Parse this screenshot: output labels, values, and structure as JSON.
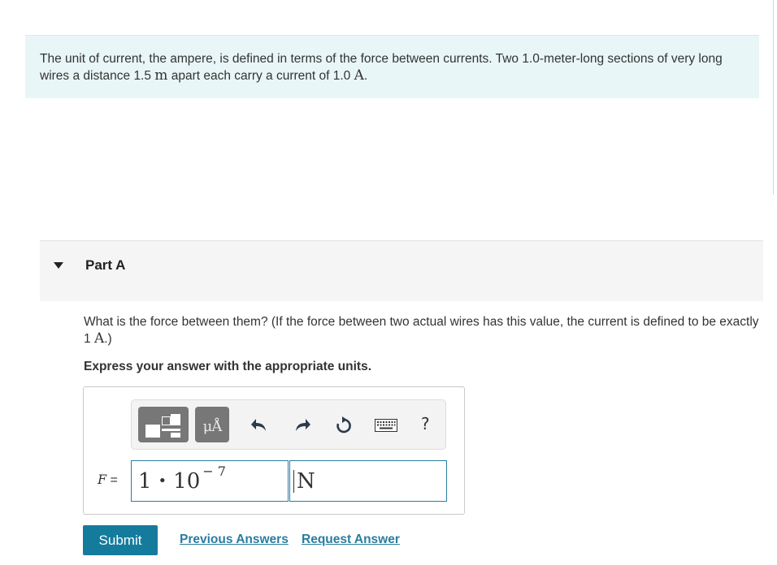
{
  "problem": {
    "text_1": "The unit of current, the ampere, is defined in terms of the force between currents. Two 1.0-meter-long sections of very long wires a distance 1.5 ",
    "unit_m": "m",
    "text_2": " apart each carry a current of 1.0 ",
    "unit_a": "A",
    "text_3": "."
  },
  "part": {
    "title": "Part A",
    "question_1": "What is the force between them? (If the force between two actual wires has this value, the current is defined to be exactly 1 ",
    "question_unit": "A",
    "question_2": ".)",
    "instruction": "Express your answer with the appropriate units."
  },
  "toolbar": {
    "units_label": "μÅ",
    "help": "?",
    "icons": [
      "templates-icon",
      "units-icon",
      "undo-icon",
      "redo-icon",
      "reset-icon",
      "keyboard-icon",
      "help-icon"
    ]
  },
  "answer": {
    "variable": "F",
    "equals": " =",
    "mantissa": "1",
    "dot": "•",
    "base": "10",
    "exponent": "− 7",
    "unit": "N"
  },
  "actions": {
    "submit": "Submit",
    "previous_answers": "Previous Answers",
    "request_answer": "Request Answer"
  },
  "colors": {
    "accent": "#157b9d",
    "link": "#2a7da0",
    "intro_bg": "#e8f6f7"
  }
}
